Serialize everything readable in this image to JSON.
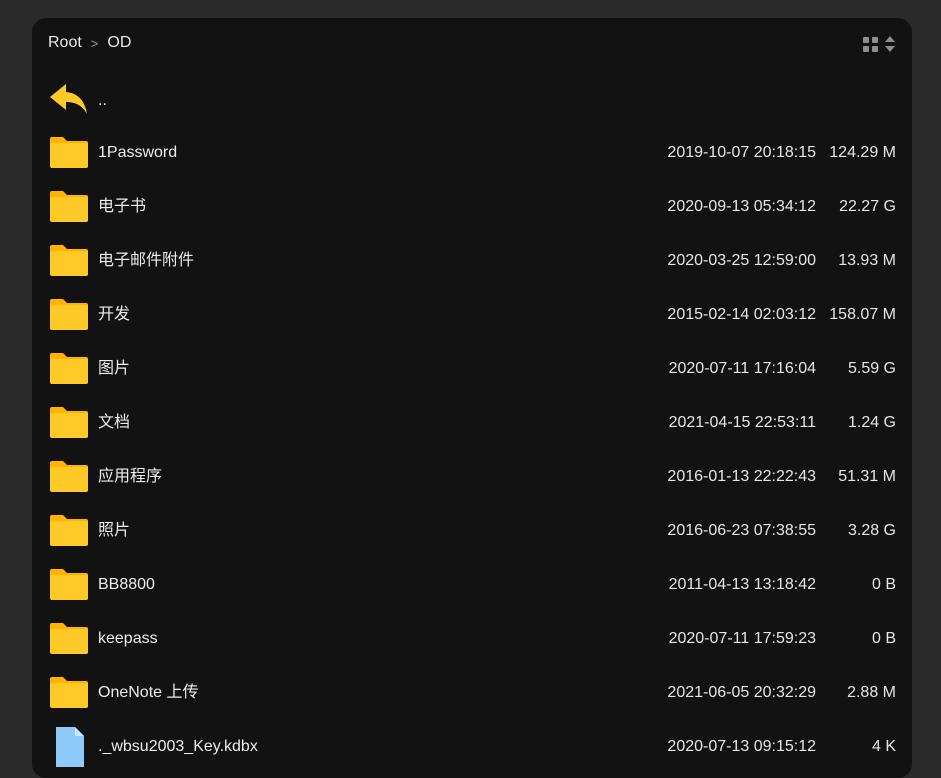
{
  "breadcrumb": {
    "root": "Root",
    "separator": ">",
    "current": "OD"
  },
  "view_controls": {
    "layout_icon": "grid-icon",
    "sort_icon": "sort-icon"
  },
  "colors": {
    "background": "#2b2b2b",
    "panel": "#121212",
    "folder": "#ffc928",
    "file": "#90caf9",
    "text": "#ededed"
  },
  "back": {
    "icon": "back-arrow-icon",
    "label": ".."
  },
  "files": [
    {
      "name": "1Password",
      "date": "2019-10-07 20:18:15",
      "size": "124.29 M",
      "type": "folder"
    },
    {
      "name": "电子书",
      "date": "2020-09-13 05:34:12",
      "size": "22.27 G",
      "type": "folder"
    },
    {
      "name": "电子邮件附件",
      "date": "2020-03-25 12:59:00",
      "size": "13.93 M",
      "type": "folder"
    },
    {
      "name": "开发",
      "date": "2015-02-14 02:03:12",
      "size": "158.07 M",
      "type": "folder"
    },
    {
      "name": "图片",
      "date": "2020-07-11 17:16:04",
      "size": "5.59 G",
      "type": "folder"
    },
    {
      "name": "文档",
      "date": "2021-04-15 22:53:11",
      "size": "1.24 G",
      "type": "folder"
    },
    {
      "name": "应用程序",
      "date": "2016-01-13 22:22:43",
      "size": "51.31 M",
      "type": "folder"
    },
    {
      "name": "照片",
      "date": "2016-06-23 07:38:55",
      "size": "3.28 G",
      "type": "folder"
    },
    {
      "name": "BB8800",
      "date": "2011-04-13 13:18:42",
      "size": "0 B",
      "type": "folder"
    },
    {
      "name": "keepass",
      "date": "2020-07-11 17:59:23",
      "size": "0 B",
      "type": "folder"
    },
    {
      "name": "OneNote 上传",
      "date": "2021-06-05 20:32:29",
      "size": "2.88 M",
      "type": "folder"
    },
    {
      "name": "._wbsu2003_Key.kdbx",
      "date": "2020-07-13 09:15:12",
      "size": "4 K",
      "type": "file"
    }
  ]
}
